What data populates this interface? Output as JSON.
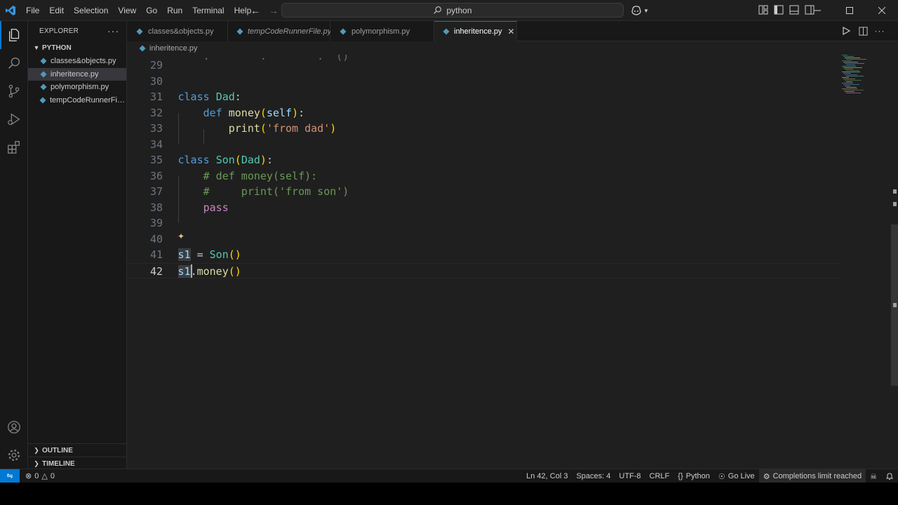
{
  "titlebar": {
    "menu": [
      "File",
      "Edit",
      "Selection",
      "View",
      "Go",
      "Run",
      "Terminal",
      "Help"
    ],
    "search_text": "python"
  },
  "sidebar": {
    "header": "EXPLORER",
    "folder": "PYTHON",
    "files": [
      "classes&objects.py",
      "inheritence.py",
      "polymorphism.py",
      "tempCodeRunnerFile.py"
    ],
    "active_file_index": 1,
    "outline": "OUTLINE",
    "timeline": "TIMELINE"
  },
  "tabs": [
    {
      "label": "classes&objects.py",
      "italic": false,
      "active": false
    },
    {
      "label": "tempCodeRunnerFile.py",
      "italic": true,
      "active": false
    },
    {
      "label": "polymorphism.py",
      "italic": false,
      "active": false
    },
    {
      "label": "inheritence.py",
      "italic": false,
      "active": true
    }
  ],
  "breadcrumb": "inheritence.py",
  "editor": {
    "current_line": 42,
    "lines": [
      {
        "n": 29,
        "text": ""
      },
      {
        "n": 30,
        "text": ""
      },
      {
        "n": 31,
        "text": "class Dad:"
      },
      {
        "n": 32,
        "text": "    def money(self):"
      },
      {
        "n": 33,
        "text": "        print('from dad')"
      },
      {
        "n": 34,
        "text": ""
      },
      {
        "n": 35,
        "text": "class Son(Dad):"
      },
      {
        "n": 36,
        "text": "    # def money(self):"
      },
      {
        "n": 37,
        "text": "    #     print('from son')"
      },
      {
        "n": 38,
        "text": "    pass"
      },
      {
        "n": 39,
        "text": ""
      },
      {
        "n": 40,
        "text": ""
      },
      {
        "n": 41,
        "text": "s1 = Son()"
      },
      {
        "n": 42,
        "text": "s1.money()"
      }
    ]
  },
  "statusbar": {
    "errors": "0",
    "warnings": "0",
    "position": "Ln 42, Col 3",
    "spaces": "Spaces: 4",
    "encoding": "UTF-8",
    "eol": "CRLF",
    "language": "Python",
    "golive": "Go Live",
    "copilot": "Completions limit reached"
  },
  "colors": {
    "accent": "#0078d4",
    "python_icon": "#519aba",
    "keyword": "#569cd6",
    "class": "#4ec9b0",
    "function": "#dcdcaa",
    "string": "#ce9178",
    "comment": "#6a9955",
    "control": "#c586c0"
  },
  "icons": [
    "vscode-logo-icon",
    "files-icon",
    "search-icon",
    "source-control-icon",
    "run-debug-icon",
    "extensions-icon",
    "account-icon",
    "manage-gear-icon"
  ]
}
